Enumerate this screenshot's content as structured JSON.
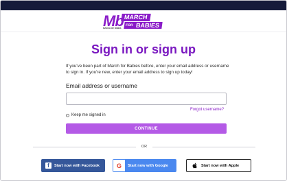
{
  "brand": {
    "logo_mark": "Mb",
    "logo_sub": "MARCH OF DIMES",
    "logo_word1": "MARCH",
    "logo_word_for": "FOR",
    "logo_word2": "BABIES",
    "accent_color": "#8a1cc8",
    "topbar_color": "#151a3a"
  },
  "signin": {
    "title": "Sign in or sign up",
    "intro": "If you've been part of March for Babies before, enter your email address or username to sign in. If you're new, enter your email address to sign up today!",
    "email_label": "Email address or username",
    "email_value": "",
    "forgot_link": "Forgot username?",
    "keep_signed_in": "Keep me signed in",
    "continue_button": "CONTINUE",
    "or_divider": "OR"
  },
  "social": {
    "facebook": {
      "label": "Start now with Facebook",
      "icon": "facebook-icon",
      "color": "#35579a"
    },
    "google": {
      "label": "Start now with Google",
      "icon": "google-icon",
      "color": "#4a88ef"
    },
    "apple": {
      "label": "Start now with Apple",
      "icon": "apple-icon",
      "color": "#ffffff"
    }
  }
}
